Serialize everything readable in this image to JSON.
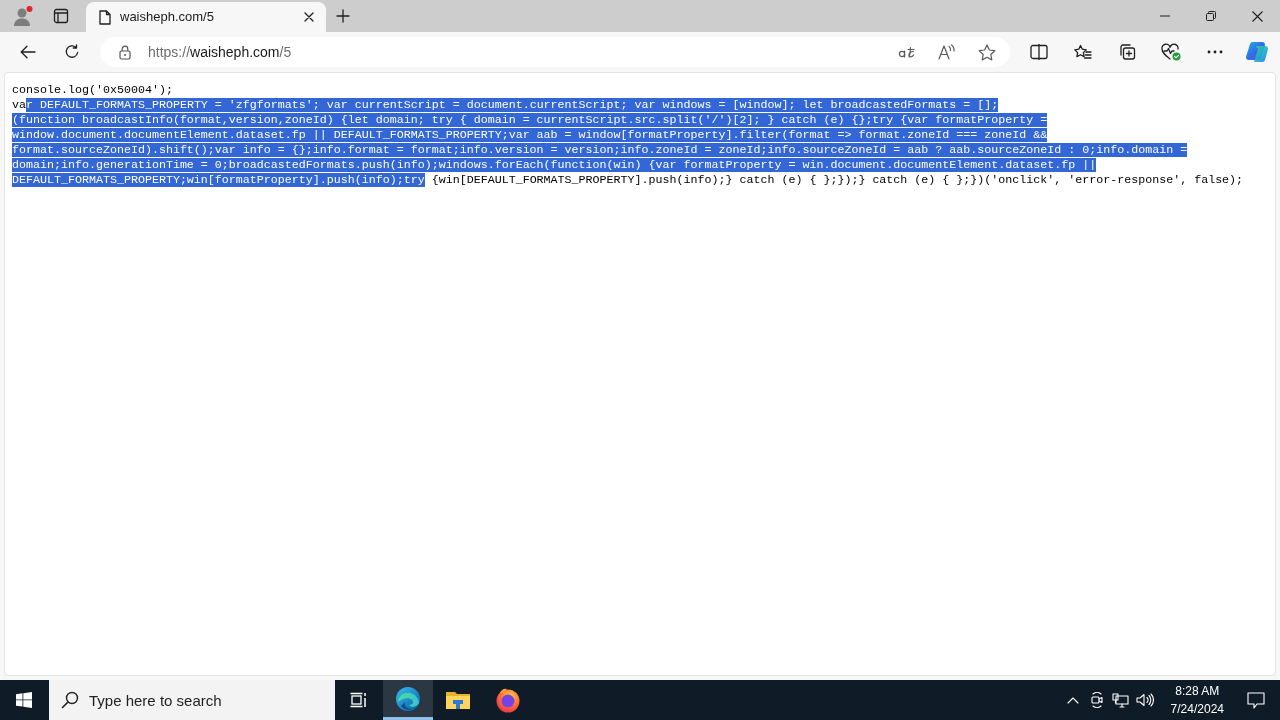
{
  "browser": {
    "profile": {
      "notification": true
    },
    "tabs": [
      {
        "title": "waisheph.com/5",
        "selected": true
      }
    ],
    "address": {
      "scheme": "https://",
      "host": "waisheph.com",
      "path": "/5"
    }
  },
  "page": {
    "lines": [
      {
        "segments": [
          {
            "text": "console.log('0x50004');",
            "selected": false
          }
        ]
      },
      {
        "segments": [
          {
            "text": "va",
            "selected": false
          },
          {
            "text": "r DEFAULT_FORMATS_PROPERTY = 'zfgformats'; var currentScript = document.currentScript; var windows = [window]; let broadcastedFormats = [];",
            "selected": true
          }
        ]
      },
      {
        "segments": [
          {
            "text": "(function broadcastInfo(format,version,zoneId) {let domain; try { domain = currentScript.src.split('/')[2]; } catch (e) {};try {var formatProperty =",
            "selected": true
          }
        ]
      },
      {
        "segments": [
          {
            "text": "window.document.documentElement.dataset.fp || DEFAULT_FORMATS_PROPERTY;var aab = window[formatProperty].filter(format => format.zoneId === zoneId &&",
            "selected": true
          }
        ]
      },
      {
        "segments": [
          {
            "text": "format.sourceZoneId).shift();var info = {};info.format = format;info.version = version;info.zoneId = zoneId;info.sourceZoneId = aab ? aab.sourceZoneId : 0;info.domain =",
            "selected": true
          }
        ]
      },
      {
        "segments": [
          {
            "text": "domain;info.generationTime = 0;broadcastedFormats.push(info);windows.forEach(function(win) {var formatProperty = win.document.documentElement.dataset.fp ||",
            "selected": true
          }
        ]
      },
      {
        "segments": [
          {
            "text": "DEFAULT_FORMATS_PROPERTY;win[formatProperty].push(info);try",
            "selected": true
          },
          {
            "text": " {win[DEFAULT_FORMATS_PROPERTY].push(info);} catch (e) { };});} catch (e) { };})('onclick', 'error-response', false);",
            "selected": false
          }
        ]
      }
    ]
  },
  "taskbar": {
    "search": {
      "placeholder": "Type here to search"
    },
    "apps": [
      {
        "kind": "edge",
        "active": true
      },
      {
        "kind": "explorer",
        "active": false
      },
      {
        "kind": "firefox",
        "active": false
      }
    ],
    "clock": {
      "time": "8:28 AM",
      "date": "7/24/2024"
    }
  }
}
